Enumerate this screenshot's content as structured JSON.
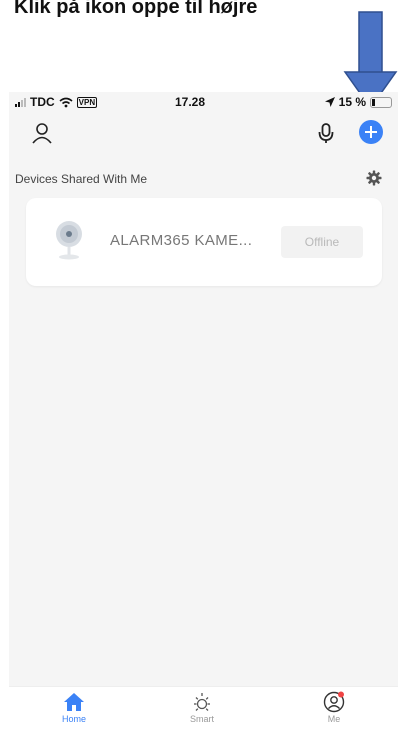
{
  "caption": "Klik på ikon oppe til højre",
  "status_bar": {
    "carrier": "TDC",
    "vpn": "VPN",
    "time": "17.28",
    "battery": "15 %"
  },
  "section": {
    "title": "Devices Shared With Me"
  },
  "device": {
    "name": "ALARM365 KAME...",
    "status": "Offline"
  },
  "tabs": [
    {
      "label": "Home",
      "icon": "home-icon",
      "active": true
    },
    {
      "label": "Smart",
      "icon": "sun-icon",
      "active": false
    },
    {
      "label": "Me",
      "icon": "user-circle-icon",
      "active": false
    }
  ],
  "colors": {
    "accent": "#3b82f6",
    "annotation_arrow": "#4a72c4",
    "background": "#f5f5f5",
    "notification_dot": "#ef4444"
  }
}
